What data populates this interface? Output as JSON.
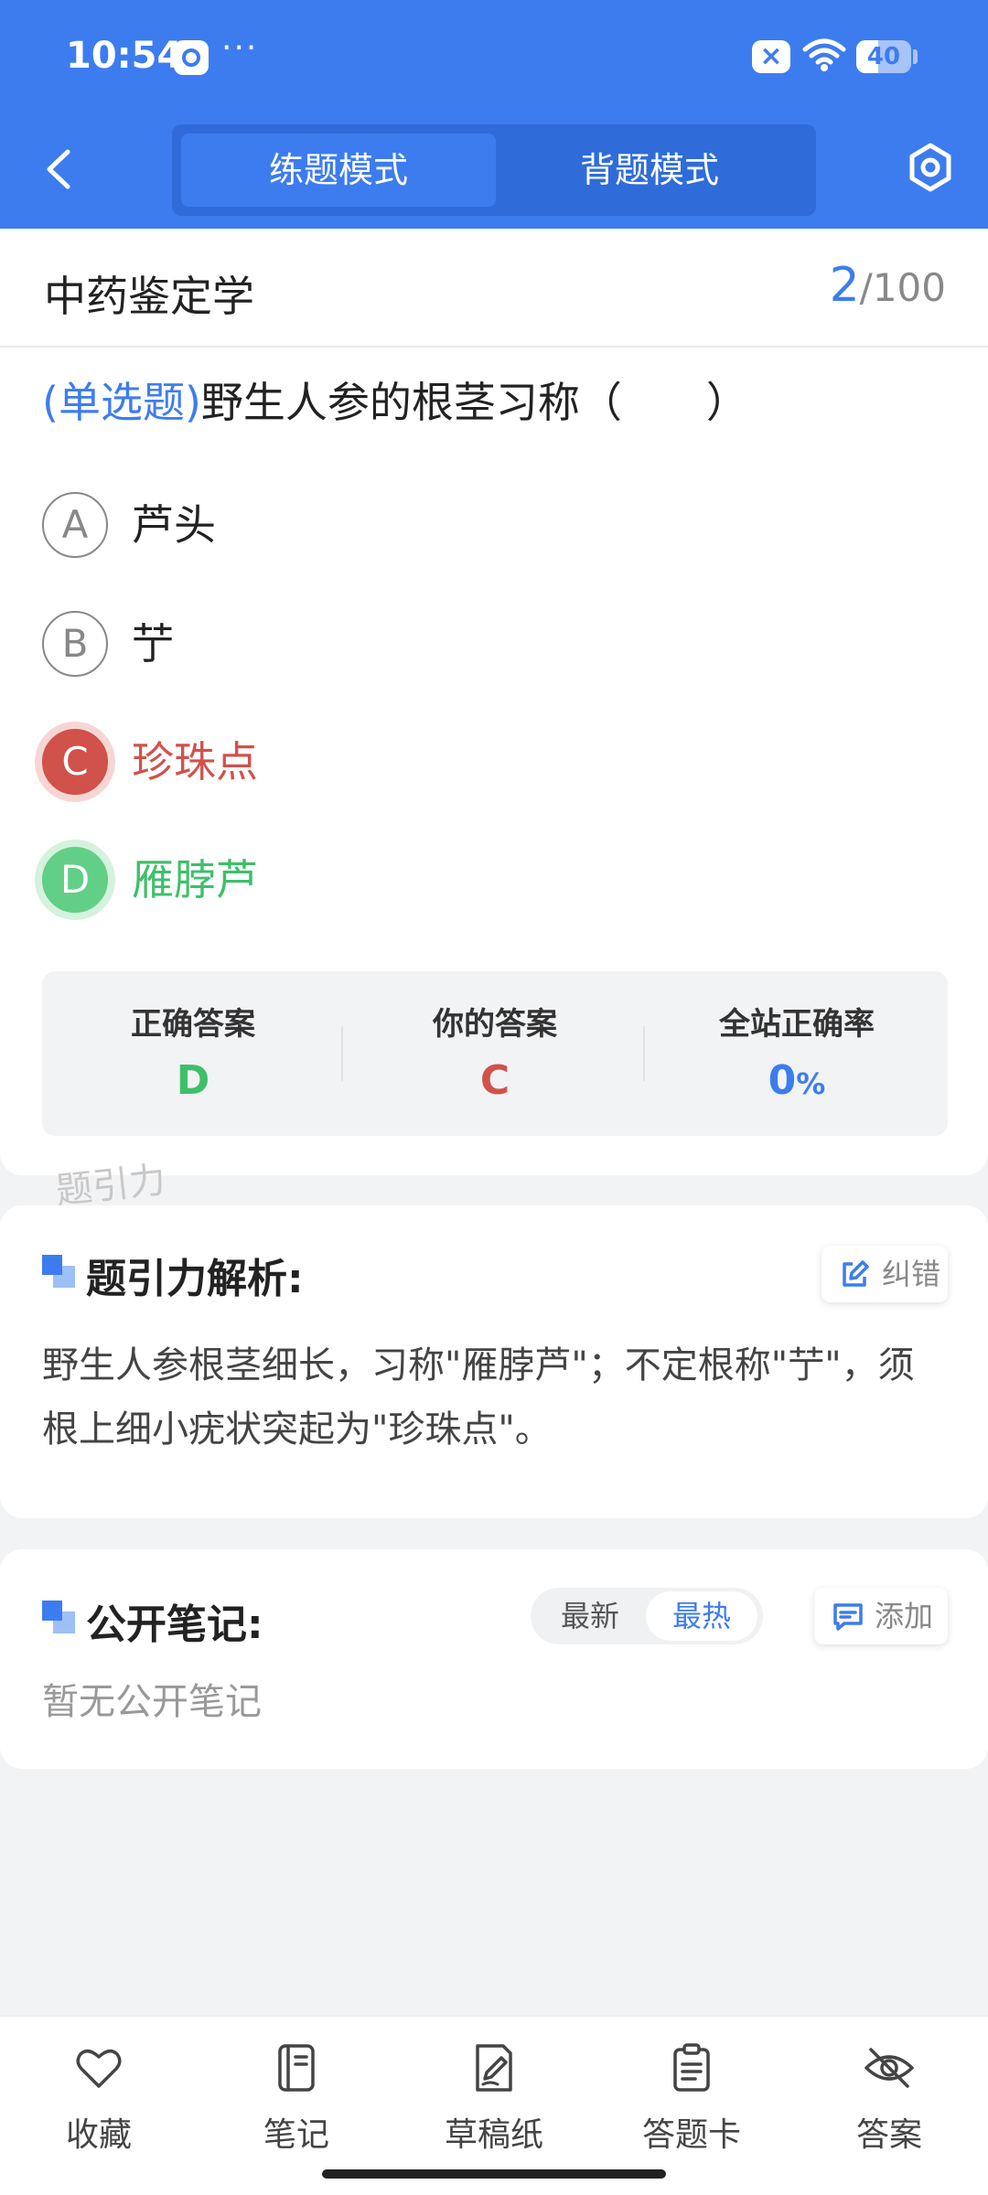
{
  "status_bar": {
    "time": "10:54",
    "more": "···",
    "battery": "40",
    "battery_fraction": 0.4
  },
  "header": {
    "tabs": [
      {
        "label": "练题模式",
        "active": true
      },
      {
        "label": "背题模式",
        "active": false
      }
    ],
    "accent_color": "#3d7cef"
  },
  "question_card": {
    "subject": "中药鉴定学",
    "counter": {
      "current": "2",
      "separator": "/",
      "total": "100"
    },
    "type": "(单选题)",
    "stem": "野生人参的根茎习称（　　）",
    "options": [
      {
        "letter": "A",
        "text": "芦头",
        "state": "normal"
      },
      {
        "letter": "B",
        "text": "艼",
        "state": "normal"
      },
      {
        "letter": "C",
        "text": "珍珠点",
        "state": "wrong"
      },
      {
        "letter": "D",
        "text": "雁脖芦",
        "state": "correct"
      }
    ],
    "result": {
      "correct_label": "正确答案",
      "correct_value": "D",
      "yours_label": "你的答案",
      "yours_value": "C",
      "rate_label": "全站正确率",
      "rate_value": "0",
      "rate_unit": "%"
    },
    "watermark": "题引力"
  },
  "analysis": {
    "title": "题引力解析:",
    "report_button": "纠错",
    "text": "野生人参根茎细长，习称\"雁脖芦\"；不定根称\"艼\"，须根上细小疣状突起为\"珍珠点\"。"
  },
  "notes": {
    "title": "公开笔记:",
    "sort_newest": "最新",
    "sort_hottest": "最热",
    "add_button": "添加",
    "empty_text": "暂无公开笔记"
  },
  "bottom_nav": [
    {
      "label": "收藏",
      "icon": "heart-icon"
    },
    {
      "label": "笔记",
      "icon": "notebook-icon"
    },
    {
      "label": "草稿纸",
      "icon": "draft-paper-icon"
    },
    {
      "label": "答题卡",
      "icon": "answer-sheet-icon"
    },
    {
      "label": "答案",
      "icon": "eye-off-icon"
    }
  ]
}
